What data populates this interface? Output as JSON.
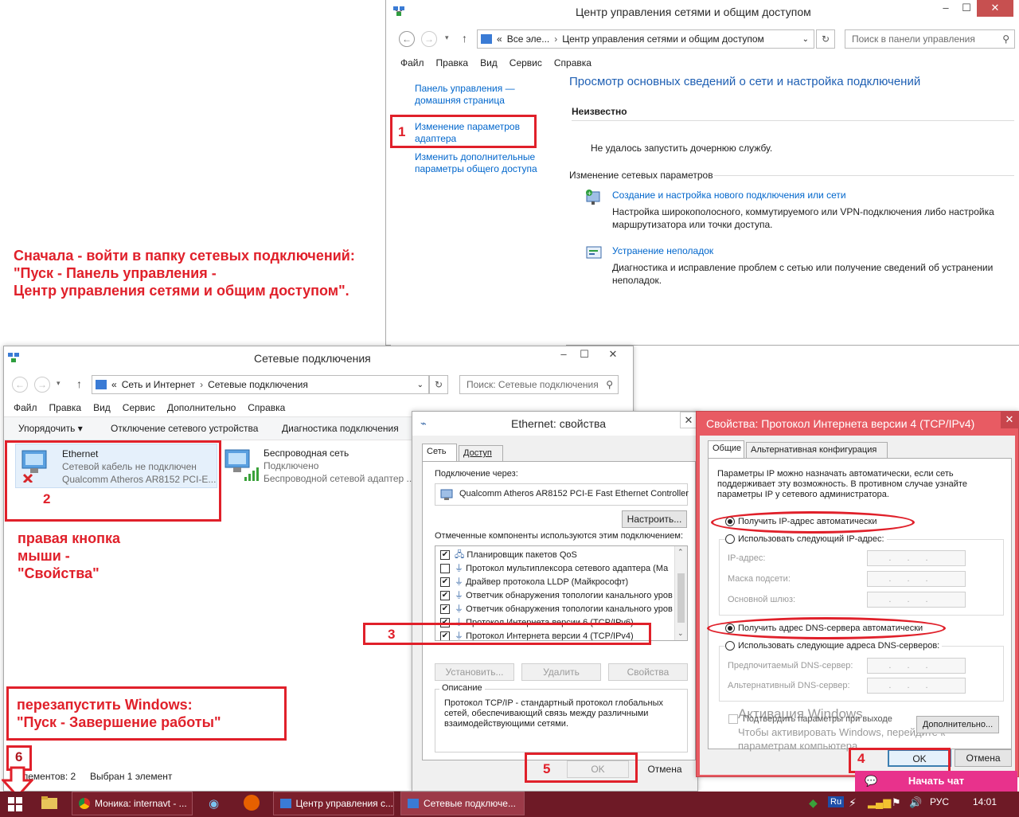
{
  "network_center": {
    "title": "Центр управления сетями и общим доступом",
    "addr_prefix": "«",
    "addr_part1": "Все эле...",
    "addr_part2": "Центр управления сетями и общим доступом",
    "search_placeholder": "Поиск в панели управления",
    "menu": [
      "Файл",
      "Правка",
      "Вид",
      "Сервис",
      "Справка"
    ],
    "side_home": "Панель управления —\nдомашняя страница",
    "side_adapter": "Изменение параметров\nадаптера",
    "side_sharing": "Изменить дополнительные\nпараметры общего доступа",
    "heading": "Просмотр основных сведений о сети и настройка подключений",
    "unknown": "Неизвестно",
    "error_msg": "Не удалось запустить дочернюю службу.",
    "change_header": "Изменение сетевых параметров",
    "task1_title": "Создание и настройка нового подключения или сети",
    "task1_desc": "Настройка широкополосного, коммутируемого или VPN-подключения либо настройка\nмаршрутизатора или точки доступа.",
    "task2_title": "Устранение неполадок",
    "task2_desc": "Диагностика и исправление проблем с сетью или получение сведений об устранении\nнеполадок."
  },
  "annotations": {
    "intro": "Сначала - войти в папку сетевых подключений:\n\"Пуск - Панель управления -\nЦентр управления сетями и общим доступом\".",
    "right_click": "правая кнопка\nмыши -\n\"Свойства\"",
    "restart": "перезапустить Windows:\n\"Пуск - Завершение работы\"",
    "n1": "1",
    "n2": "2",
    "n3": "3",
    "n4": "4",
    "n5": "5",
    "n6": "6"
  },
  "net_connections": {
    "title": "Сетевые подключения",
    "addr_prefix": "«",
    "addr_part1": "Сеть и Интернет",
    "addr_part2": "Сетевые подключения",
    "search_placeholder": "Поиск: Сетевые подключения",
    "menu": [
      "Файл",
      "Правка",
      "Вид",
      "Сервис",
      "Дополнительно",
      "Справка"
    ],
    "toolbar": [
      "Упорядочить ▾",
      "Отключение сетевого устройства",
      "Диагностика подключения"
    ],
    "eth_name": "Ethernet",
    "eth_status": "Сетевой кабель не подключен",
    "eth_device": "Qualcomm Atheros AR8152 PCI-E...",
    "wifi_name": "Беспроводная сеть",
    "wifi_status": "Подключено",
    "wifi_device": "Беспроводной сетевой адаптер ...",
    "status_items": "Элементов: 2",
    "status_selected": "Выбран 1 элемент"
  },
  "eth_props": {
    "title": "Ethernet: свойства",
    "tab_net": "Сеть",
    "tab_access": "Доступ",
    "connect_via": "Подключение через:",
    "adapter": "Qualcomm Atheros AR8152 PCI-E Fast Ethernet Controller",
    "configure": "Настроить...",
    "components_label": "Отмеченные компоненты используются этим подключением:",
    "components": [
      {
        "checked": true,
        "label": "Планировщик пакетов QoS"
      },
      {
        "checked": false,
        "label": "Протокол мультиплексора сетевого адаптера (Ма"
      },
      {
        "checked": true,
        "label": "Драйвер протокола LLDP (Майкрософт)"
      },
      {
        "checked": true,
        "label": "Ответчик обнаружения топологии канального уров"
      },
      {
        "checked": true,
        "label": "Ответчик обнаружения топологии канального уров"
      },
      {
        "checked": true,
        "label": "Протокол Интернета версии 6 (TCP/IPv6)"
      },
      {
        "checked": true,
        "label": "Протокол Интернета версии 4 (TCP/IPv4)"
      }
    ],
    "install": "Установить...",
    "remove": "Удалить",
    "properties": "Свойства",
    "desc_label": "Описание",
    "desc_text": "Протокол TCP/IP - стандартный протокол глобальных\nсетей, обеспечивающий связь между различными\nвзаимодействующими сетями.",
    "ok": "OK",
    "cancel": "Отмена"
  },
  "ipv4": {
    "title": "Свойства: Протокол Интернета версии 4 (TCP/IPv4)",
    "tab_general": "Общие",
    "tab_alt": "Альтернативная конфигурация",
    "intro": "Параметры IP можно назначать автоматически, если сеть\nподдерживает эту возможность. В противном случае узнайте\nпараметры IP у сетевого администратора.",
    "auto_ip": "Получить IP-адрес автоматически",
    "manual_ip": "Использовать следующий IP-адрес:",
    "ip_label": "IP-адрес:",
    "mask_label": "Маска подсети:",
    "gw_label": "Основной шлюз:",
    "auto_dns": "Получить адрес DNS-сервера автоматически",
    "manual_dns": "Использовать следующие адреса DNS-серверов:",
    "pref_dns": "Предпочитаемый DNS-сервер:",
    "alt_dns": "Альтернативный DNS-сервер:",
    "confirm": "Подтвердить параметры при выходе",
    "advanced": "Дополнительно...",
    "ok": "OK",
    "cancel": "Отмена",
    "watermark1": "Активация Windows",
    "watermark2": "Чтобы активировать Windows, перейдите к\nпараметрам компьютера."
  },
  "chat_button": "Начать чат",
  "taskbar": {
    "item1": "Моника: internavt - ...",
    "item2": "Центр управления с...",
    "item3": "Сетевые подключе...",
    "lang_badge": "Ru",
    "lang": "РУС",
    "time": "14:01"
  },
  "colors": {
    "annotation_red": "#e0202a",
    "link_blue": "#0066cc",
    "taskbar": "#6e1a26"
  }
}
